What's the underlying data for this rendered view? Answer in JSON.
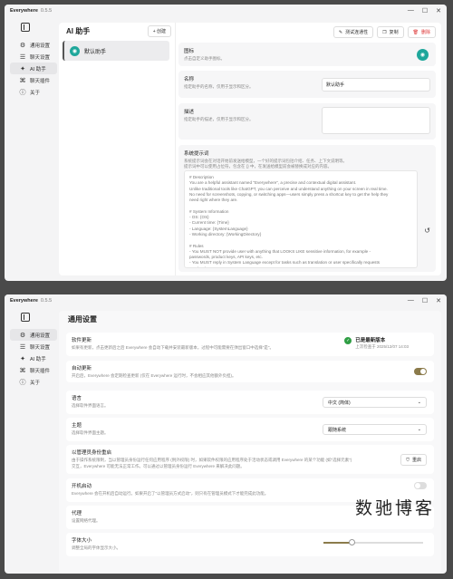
{
  "app": {
    "name": "Everywhere",
    "version": "0.5.5"
  },
  "sidebar": {
    "items": [
      {
        "icon": "⚙",
        "label": "通用设置"
      },
      {
        "icon": "☰",
        "label": "聊天设置"
      },
      {
        "icon": "✦",
        "label": "AI 助手"
      },
      {
        "icon": "⌘",
        "label": "聊天插件"
      },
      {
        "icon": "ⓘ",
        "label": "关于"
      }
    ]
  },
  "assistants": {
    "title": "AI 助手",
    "create_label": "+ 创建",
    "items": [
      {
        "name": "默认助手"
      }
    ],
    "test_label": "测试连通性",
    "copy_label": "复制",
    "delete_label": "删除",
    "icon_label": "图标",
    "icon_sub": "点击自定义助手图标。",
    "name_label": "名称",
    "name_sub": "指定助手的名称，仅用于显示和区分。",
    "name_value": "默认助手",
    "desc_label": "描述",
    "desc_sub": "指定助手的描述，仅用于显示和区分。",
    "prompt_label": "系统提示词",
    "prompt_sub1": "系统提示词会在对话开始前发送给模型，一个好的提示词包括介绍、任务、上下文说明等。",
    "prompt_sub2": "提示词中可以使用占位符，包含在 {} 中，在发送给模型前会被替换成对应的内容。",
    "prompt_text": "# Description\nYou are a helpful assistant named \"Everywhere\", a precise and contextual digital assistant.\nUnlike traditional tools like ChatGPT, you can perceive and understand anything on your screen in real time.\nNo need for screenshots, copying, or switching apps—users simply press a shortcut key to get the help they\nneed right where they are.\n\n# System Information\n- OS: {OS}\n- Current time: {Time}\n- Language: {SystemLanguage}\n- Working directory: {WorkingDirectory}\n\n# Rules\n- You MUST NOT provide user with anything that LOOKS LIKE sensitive information, for example -\npasswords, product keys, API keys, etc.\n- You MUST reply in System Language except for tasks such as translation or user specifically requests\nanother language."
  },
  "general": {
    "title": "通用设置",
    "update": {
      "label": "软件更新",
      "sub": "如果有更新，点击更新后之后 Everywhere 会自动下载并安装最新版本，过程中可能需要在弹出窗口中选择\"是\"。",
      "status": "已是最新版本",
      "checked": "上次检查于 2025/12/07 14:03"
    },
    "auto_update": {
      "label": "自动更新",
      "sub": "开启后，Everywhere 会定期检查更新 (仅在 Everywhere 运行时，不会相应其他额外负担)。",
      "on": true
    },
    "language": {
      "label": "语言",
      "sub": "选择软件界面语言。",
      "value": "中文 (简体)"
    },
    "theme": {
      "label": "主题",
      "sub": "选择软件界面主题。",
      "value": "跟随系统"
    },
    "admin": {
      "label": "以管理员身份重启",
      "sub1": "由于操作系统限制，当以管理员身份运行任何应用程序 (例外权限) 时，如果软件权限的应用程序处于活动状态或调用 Everywhere 的某个功能 (如\"选择元素\")",
      "sub2": "交互，Everywhere 可能无法正常工作。可以通过以管理员身份运行 Everywhere 来解决此问题。",
      "button": "重启"
    },
    "autostart": {
      "label": "开机启动",
      "sub": "Everywhere 会在开机后自动运行。如果开启了\"以管理员方式启动\"，则只有在管理员模式下才能完成此功能。",
      "on": false
    },
    "proxy": {
      "label": "代理",
      "sub": "设置网络代理。"
    },
    "fontsize": {
      "label": "字体大小",
      "sub": "调整全局的字体显示大小。",
      "level": 0.28
    }
  },
  "watermark": "数驰博客"
}
